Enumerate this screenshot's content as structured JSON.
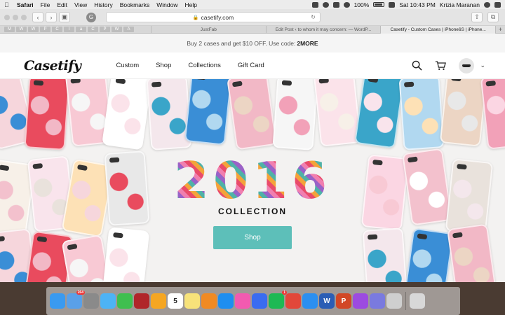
{
  "menubar": {
    "app": "Safari",
    "items": [
      "File",
      "Edit",
      "View",
      "History",
      "Bookmarks",
      "Window",
      "Help"
    ],
    "battery": "100%",
    "clock": "Sat 10:43 PM",
    "user": "Krizia Maranan"
  },
  "toolbar": {
    "url": "casetify.com",
    "g_label": "G"
  },
  "bookmarks": [
    "M",
    "W",
    "W",
    "P",
    "C",
    "I",
    "a",
    "C",
    "P",
    "W",
    "A"
  ],
  "tabs": [
    {
      "label": "JustFab",
      "active": false
    },
    {
      "label": "Edit Post ‹ to whom it may concern: — WordP...",
      "active": false
    },
    {
      "label": "Casetify - Custom Cases | iPhone6S | iPhone...",
      "active": true
    }
  ],
  "promo": {
    "text": "Buy 2 cases and get $10 OFF. Use code:",
    "code": "2MORE"
  },
  "header": {
    "logo": "Casetify",
    "nav": [
      "Custom",
      "Shop",
      "Collections",
      "Gift Card"
    ]
  },
  "hero": {
    "number": "2016",
    "subtitle": "COLLECTION",
    "button": "Shop",
    "case_colors": [
      "#f6d6dc",
      "#e94b5e",
      "#f8c9d4",
      "#ffffff",
      "#f4e7ec",
      "#3a8ed6",
      "#f2b8c6",
      "#f6f6f6",
      "#fbe3ea",
      "#3aa5c9",
      "#b1d8f0",
      "#ecd5c4",
      "#f2a1b8",
      "#f7f0e8",
      "#f9e4ec",
      "#fde1b6",
      "#e8e8e8",
      "#fbd6e3",
      "#f3c1cd",
      "#e9e2dc"
    ]
  },
  "dock": {
    "apps": [
      {
        "name": "finder",
        "color": "#3a9af0"
      },
      {
        "name": "mail",
        "color": "#5aa0e8",
        "badge": "264"
      },
      {
        "name": "system-preferences",
        "color": "#8a8a8a"
      },
      {
        "name": "messages",
        "color": "#4db3f5"
      },
      {
        "name": "facetime",
        "color": "#3fbf4f"
      },
      {
        "name": "photo-booth",
        "color": "#b0262a"
      },
      {
        "name": "photos",
        "color": "#f5a623"
      },
      {
        "name": "calendar",
        "color": "#ffffff",
        "label": "5"
      },
      {
        "name": "notes",
        "color": "#f7e27a"
      },
      {
        "name": "ibooks",
        "color": "#f08a24"
      },
      {
        "name": "app-store",
        "color": "#1e8ef0"
      },
      {
        "name": "itunes",
        "color": "#f25ab0"
      },
      {
        "name": "maps-pin",
        "color": "#3a6cf0"
      },
      {
        "name": "spotify",
        "color": "#1db954",
        "badge": "1"
      },
      {
        "name": "chrome",
        "color": "#e2473a"
      },
      {
        "name": "safari",
        "color": "#2b8ff0"
      },
      {
        "name": "word",
        "color": "#2b5db5",
        "label": "W"
      },
      {
        "name": "powerpoint",
        "color": "#d24726",
        "label": "P"
      },
      {
        "name": "color-app",
        "color": "#9c4be0"
      },
      {
        "name": "downloads",
        "color": "#7a7adf"
      },
      {
        "name": "drive",
        "color": "#cfcfcf"
      },
      {
        "name": "trash",
        "color": "#d8d8d8"
      }
    ]
  }
}
